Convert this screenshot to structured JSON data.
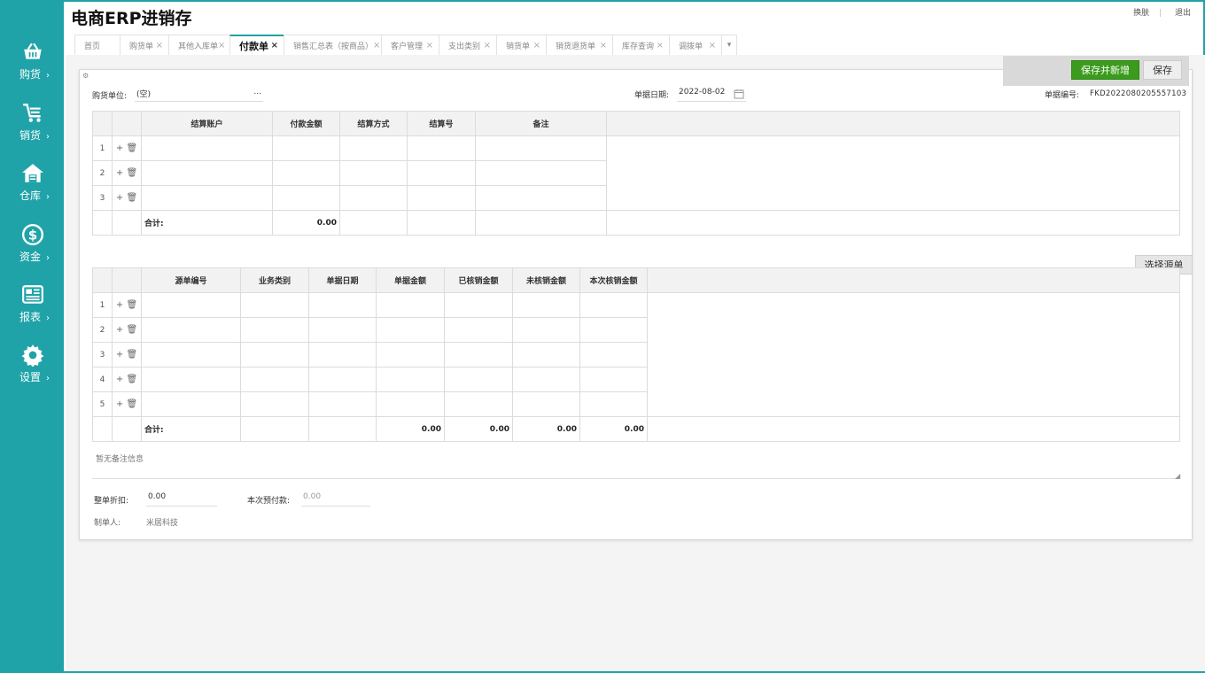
{
  "app": {
    "title": "电商ERP进销存"
  },
  "top_links": {
    "skin": "换肤",
    "logout": "退出"
  },
  "sidebar": {
    "items": [
      {
        "label": "购货",
        "icon": "basket-icon"
      },
      {
        "label": "销货",
        "icon": "cart-icon"
      },
      {
        "label": "仓库",
        "icon": "warehouse-icon"
      },
      {
        "label": "资金",
        "icon": "dollar-icon"
      },
      {
        "label": "报表",
        "icon": "report-icon"
      },
      {
        "label": "设置",
        "icon": "gear-icon"
      }
    ],
    "chevron": "›"
  },
  "tabs": [
    {
      "label": "首页",
      "closable": false
    },
    {
      "label": "购货单",
      "closable": true
    },
    {
      "label": "其他入库单",
      "closable": true
    },
    {
      "label": "付款单",
      "closable": true,
      "active": true
    },
    {
      "label": "销售汇总表（按商品）",
      "closable": true
    },
    {
      "label": "客户管理",
      "closable": true
    },
    {
      "label": "支出类别",
      "closable": true
    },
    {
      "label": "销货单",
      "closable": true
    },
    {
      "label": "销货退货单",
      "closable": true
    },
    {
      "label": "库存查询",
      "closable": true
    },
    {
      "label": "调拨单",
      "closable": true
    }
  ],
  "tab_close_glyph": "×",
  "tab_more_glyph": "▾",
  "actions": {
    "save_new": "保存并新增",
    "save": "保存"
  },
  "form": {
    "supplier_label": "购货单位:",
    "supplier_value": "(空)",
    "supplier_more": "...",
    "date_label": "单据日期:",
    "date_value": "2022-08-02",
    "doc_no_label": "单据编号:",
    "doc_no_value": "FKD2022080205557103"
  },
  "payment_table": {
    "headers": [
      "结算账户",
      "付款金额",
      "结算方式",
      "结算号",
      "备注"
    ],
    "rows": [
      "1",
      "2",
      "3"
    ],
    "ops": "+ 🗑",
    "total_label": "合计:",
    "total_amount": "0.00"
  },
  "select_source_label": "选择源单",
  "source_table": {
    "headers": [
      "源单编号",
      "业务类别",
      "单据日期",
      "单据金额",
      "已核销金额",
      "未核销金额",
      "本次核销金额"
    ],
    "rows": [
      "1",
      "2",
      "3",
      "4",
      "5"
    ],
    "ops": "+ 🗑",
    "total_label": "合计:",
    "totals": [
      "0.00",
      "0.00",
      "0.00",
      "0.00"
    ]
  },
  "remark_placeholder": "暂无备注信息",
  "footer": {
    "discount_label": "整单折扣:",
    "discount_value": "0.00",
    "payable_label": "本次预付款:",
    "payable_value": "0.00",
    "maker_label": "制单人:",
    "maker_value": "米居科技"
  }
}
